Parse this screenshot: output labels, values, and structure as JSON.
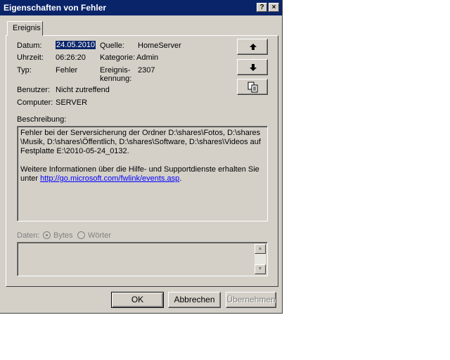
{
  "window": {
    "title": "Eigenschaften von Fehler",
    "help_btn": "?",
    "close_btn": "×"
  },
  "tab": {
    "label": "Ereignis"
  },
  "fields": {
    "datum_label": "Datum:",
    "datum_value": "24.05.2010",
    "uhrzeit_label": "Uhrzeit:",
    "uhrzeit_value": "06:26:20",
    "typ_label": "Typ:",
    "typ_value": "Fehler",
    "benutzer_label": "Benutzer:",
    "benutzer_value": "Nicht zutreffend",
    "computer_label": "Computer:",
    "computer_value": "SERVER",
    "quelle_label": "Quelle:",
    "quelle_value": "HomeServer",
    "kategorie_label": "Kategorie:",
    "kategorie_value": "Admin",
    "kennung_label_1": "Ereignis-",
    "kennung_label_2": "kennung:",
    "kennung_value": "2307"
  },
  "side_buttons": {
    "up_icon": "arrow-up",
    "down_icon": "arrow-down",
    "copy_icon": "copy"
  },
  "description": {
    "label": "Beschreibung:",
    "line1": "Fehler bei der Serversicherung der Ordner D:\\shares\\Fotos, D:\\shares",
    "line2": "\\Musik, D:\\shares\\Öffentlich, D:\\shares\\Software, D:\\shares\\Videos auf",
    "line3": "Festplatte E:\\2010-05-24_0132.",
    "line4": "Weitere Informationen über die Hilfe- und Supportdienste erhalten Sie",
    "line5_prefix": "unter ",
    "link": "http://go.microsoft.com/fwlink/events.asp",
    "line5_suffix": "."
  },
  "data_section": {
    "label": "Daten:",
    "bytes": "Bytes",
    "words": "Wörter"
  },
  "footer": {
    "ok": "OK",
    "cancel": "Abbrechen",
    "apply": "Übernehmen"
  }
}
